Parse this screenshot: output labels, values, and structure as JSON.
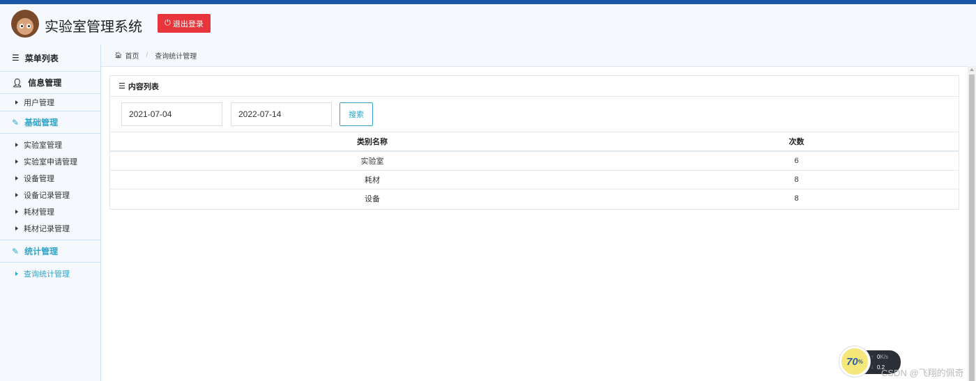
{
  "app": {
    "title": "实验室管理系统",
    "logout_label": "退出登录"
  },
  "sidebar": {
    "menu_title": "菜单列表",
    "groups": [
      {
        "label": "信息管理",
        "items": [
          "用户管理"
        ]
      },
      {
        "label": "基础管理",
        "items": [
          "实验室管理",
          "实验室申请管理",
          "设备管理",
          "设备记录管理",
          "耗材管理",
          "耗材记录管理"
        ]
      },
      {
        "label": "统计管理",
        "items": [
          "查询统计管理"
        ]
      }
    ]
  },
  "breadcrumb": {
    "home": "首页",
    "current": "查询统计管理"
  },
  "panel": {
    "title": "内容列表",
    "start_date": "2021-07-04",
    "end_date": "2022-07-14",
    "search_label": "搜索",
    "columns": [
      "类别名称",
      "次数"
    ],
    "rows": [
      {
        "name": "实验室",
        "count": "6"
      },
      {
        "name": "耗材",
        "count": "8"
      },
      {
        "name": "设备",
        "count": "8"
      }
    ]
  },
  "overlay": {
    "percent": "70",
    "percent_unit": "%",
    "up_speed": "0",
    "up_unit": "K/s",
    "down_speed": "0.2",
    "watermark": "CSDN @飞翔的佩奇"
  },
  "colors": {
    "accent": "#2fa4c9",
    "danger": "#e8353b",
    "topbar": "#1a56a5"
  }
}
